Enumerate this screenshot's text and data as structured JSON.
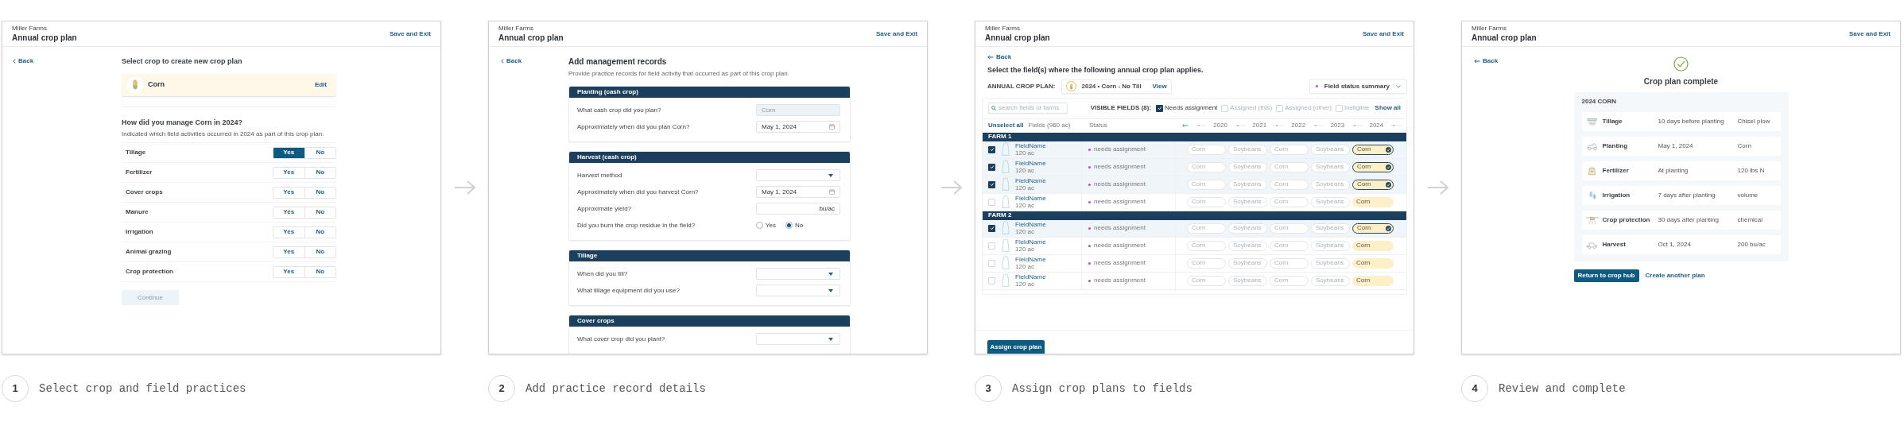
{
  "steps": [
    {
      "number": "1",
      "caption": "Select crop and field practices",
      "screen": {
        "kind": "select_crop",
        "org": "Miller Farms",
        "title": "Annual crop plan",
        "save": "Save and Exit",
        "back": "Back",
        "heading": "Select crop to create new crop plan",
        "crop": {
          "name": "Corn",
          "edit": "Edit"
        },
        "question": "How did you manage Corn in 2024?",
        "hint": "Indicated which field activities occurred in 2024 as part of this crop plan.",
        "practices": [
          {
            "label": "Tillage",
            "options": [
              {
                "label": "Yes",
                "selected": true
              },
              {
                "label": "No",
                "selected": false
              }
            ]
          },
          {
            "label": "Fertilizer",
            "options": [
              {
                "label": "Yes",
                "selected": false
              },
              {
                "label": "No",
                "selected": false
              }
            ]
          },
          {
            "label": "Cover crops",
            "options": [
              {
                "label": "Yes",
                "selected": false
              },
              {
                "label": "No",
                "selected": false
              }
            ]
          },
          {
            "label": "Manure",
            "options": [
              {
                "label": "Yes",
                "selected": false
              },
              {
                "label": "No",
                "selected": false
              }
            ]
          },
          {
            "label": "Irrigation",
            "options": [
              {
                "label": "Yes",
                "selected": false
              },
              {
                "label": "No",
                "selected": false
              }
            ]
          },
          {
            "label": "Animal grazing",
            "options": [
              {
                "label": "Yes",
                "selected": false
              },
              {
                "label": "No",
                "selected": false
              }
            ]
          },
          {
            "label": "Crop protection",
            "options": [
              {
                "label": "Yes",
                "selected": false
              },
              {
                "label": "No",
                "selected": false
              }
            ]
          }
        ],
        "continue": {
          "label": "Continue",
          "disabled": true
        }
      }
    },
    {
      "number": "2",
      "caption": "Add practice record details",
      "screen": {
        "kind": "records",
        "org": "Miller Farms",
        "title": "Annual crop plan",
        "save": "Save and Exit",
        "back": "Back",
        "heading": "Add management records",
        "hint": "Provide practice records for field activity that occurred as part of this crop plan.",
        "sections": [
          {
            "title": "Planting (cash crop)",
            "fields": [
              {
                "label": "What cash crop did you plan?",
                "kind": "text",
                "value": "Corn",
                "disabled": true
              },
              {
                "label": "Approximately when did you plan Corn?",
                "kind": "date",
                "value": "May 1, 2024"
              }
            ]
          },
          {
            "title": "Harvest (cash crop)",
            "fields": [
              {
                "label": "Harvest method",
                "kind": "select"
              },
              {
                "label": "Approximately when did you harvest Corn?",
                "kind": "date",
                "value": "May 1, 2024"
              },
              {
                "label": "Approximate yield?",
                "kind": "unit",
                "unit": "bu/ac"
              },
              {
                "label": "Did you burn the crop residue in the field?",
                "kind": "radio",
                "options": [
                  {
                    "label": "Yes",
                    "selected": false
                  },
                  {
                    "label": "No",
                    "selected": true
                  }
                ]
              }
            ]
          },
          {
            "title": "Tillage",
            "fields": [
              {
                "label": "When did you till?",
                "kind": "select"
              },
              {
                "label": "What tillage equipment did you use?",
                "kind": "select"
              }
            ]
          },
          {
            "title": "Cover crops",
            "fields": [
              {
                "label": "What cover crop did you plant?",
                "kind": "select"
              }
            ]
          }
        ]
      }
    },
    {
      "number": "3",
      "caption": "Assign crop plans to fields",
      "screen": {
        "kind": "assign",
        "org": "Miller Farms",
        "title": "Annual crop plan",
        "save": "Save and Exit",
        "back": "Back",
        "heading": "Select the field(s) where the following annual crop plan applies.",
        "plan_label": "ANNUAL CROP PLAN:",
        "plan": "2024 • Corn - No Till",
        "view": "View",
        "summary": "Field status summary",
        "search_placeholder": "search fields or farms",
        "visible_label": "VISIBLE FIELDS (8):",
        "filters": [
          {
            "label": "Needs assignment",
            "checked": true
          },
          {
            "label": "Assigned (this)",
            "checked": false
          },
          {
            "label": "Assigned (other)",
            "checked": false
          },
          {
            "label": "Ineligible",
            "checked": false
          }
        ],
        "show_all": "Show all",
        "unselect": "Unselect all",
        "fields_column": "Fields (960 ac)",
        "status_column": "Status",
        "years": [
          "2020",
          "2021",
          "2022",
          "2023",
          "2024"
        ],
        "groups": [
          {
            "name": "FARM 1",
            "rows": [
              {
                "name": "FieldName",
                "area": "120 ac",
                "status": "needs assignment",
                "checked": true,
                "history": [
                  "Corn",
                  "Soybeans",
                  "Corn",
                  "Soybeans"
                ],
                "current": "Corn",
                "assigned": true
              },
              {
                "name": "FieldName",
                "area": "120 ac",
                "status": "needs assignment",
                "checked": true,
                "history": [
                  "Corn",
                  "Soybeans",
                  "Corn",
                  "Soybeans"
                ],
                "current": "Corn",
                "assigned": true
              },
              {
                "name": "FieldName",
                "area": "120 ac",
                "status": "needs assignment",
                "checked": true,
                "history": [
                  "Corn",
                  "Soybeans",
                  "Corn",
                  "Soybeans"
                ],
                "current": "Corn",
                "assigned": true
              },
              {
                "name": "FieldName",
                "area": "120 ac",
                "status": "needs assignment",
                "checked": false,
                "history": [
                  "Corn",
                  "Soybeans",
                  "Corn",
                  "Soybeans"
                ],
                "current": "Corn",
                "assigned": false
              }
            ]
          },
          {
            "name": "FARM 2",
            "rows": [
              {
                "name": "FieldName",
                "area": "120 ac",
                "status": "needs assignment",
                "checked": true,
                "history": [
                  "Corn",
                  "Soybeans",
                  "Corn",
                  "Soybeans"
                ],
                "current": "Corn",
                "assigned": true
              },
              {
                "name": "FieldName",
                "area": "120 ac",
                "status": "needs assignment",
                "checked": false,
                "history": [
                  "Corn",
                  "Soybeans",
                  "Corn",
                  "Soybeans"
                ],
                "current": "Corn",
                "assigned": false
              },
              {
                "name": "FieldName",
                "area": "120 ac",
                "status": "needs assignment",
                "checked": false,
                "history": [
                  "Corn",
                  "Soybeans",
                  "Corn",
                  "Soybeans"
                ],
                "current": "Corn",
                "assigned": false
              },
              {
                "name": "FieldName",
                "area": "120 ac",
                "status": "needs assignment",
                "checked": false,
                "history": [
                  "Corn",
                  "Soybeans",
                  "Corn",
                  "Soybeans"
                ],
                "current": "Corn",
                "assigned": false
              }
            ]
          }
        ],
        "assign": "Assign crop plan"
      }
    },
    {
      "number": "4",
      "caption": "Review and complete",
      "screen": {
        "kind": "complete",
        "org": "Miller Farms",
        "title": "Annual crop plan",
        "save": "Save and Exit",
        "back": "Back",
        "heading": "Crop plan complete",
        "card_title": "2024 CORN",
        "records": [
          {
            "kind": "tillage",
            "name": "Tillage",
            "timing": "10 days before planting",
            "detail": "Chisel plow"
          },
          {
            "kind": "planting",
            "name": "Planting",
            "timing": "May 1, 2024",
            "detail": "Corn"
          },
          {
            "kind": "fertilizer",
            "name": "Fertilizer",
            "timing": "At planting",
            "detail": "120 lbs N"
          },
          {
            "kind": "irrigation",
            "name": "Irrigation",
            "timing": "7 days after planting",
            "detail": "volume"
          },
          {
            "kind": "spraying",
            "name": "Crop protection",
            "timing": "30 days after planting",
            "detail": "chemical"
          },
          {
            "kind": "harvest",
            "name": "Harvest",
            "timing": "Oct 1, 2024",
            "detail": "200 bu/ac"
          }
        ],
        "primary": "Return to crop hub",
        "secondary": "Create another plan"
      }
    }
  ]
}
